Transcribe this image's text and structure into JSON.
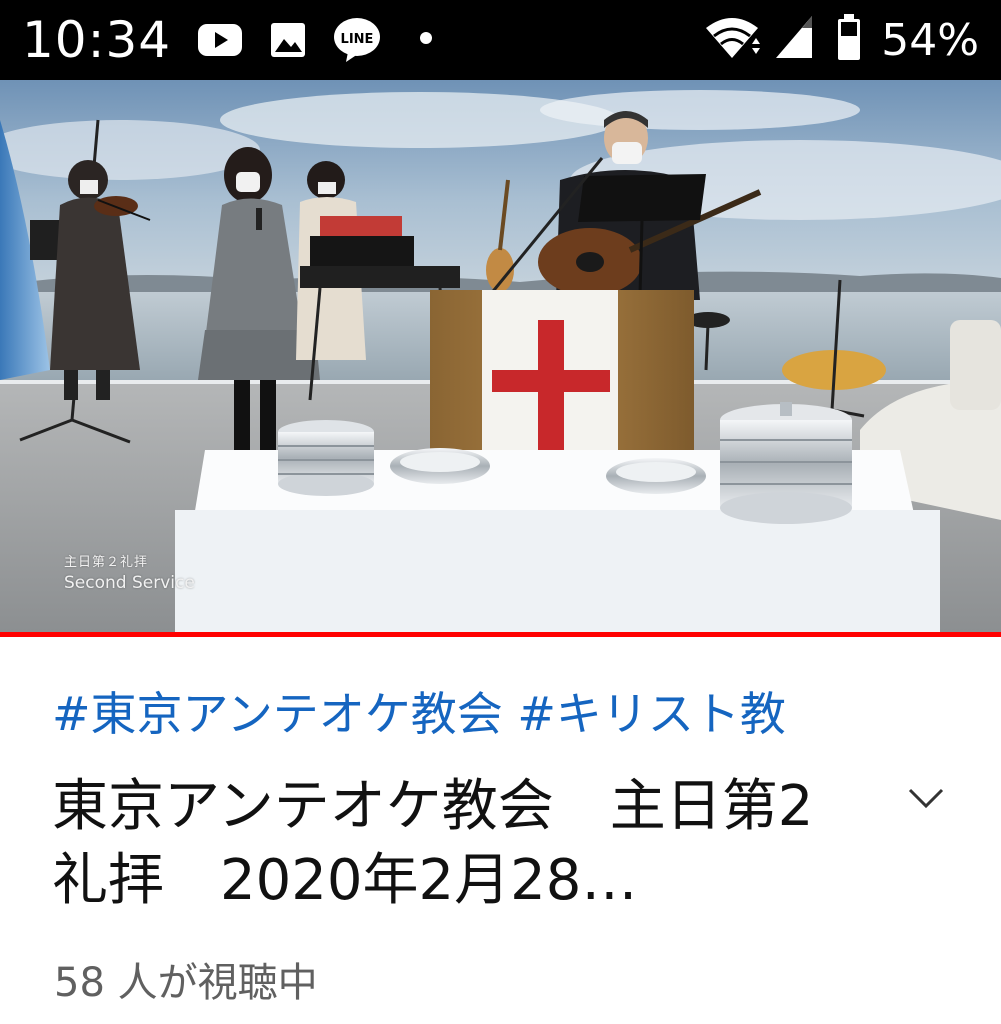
{
  "status_bar": {
    "time": "10:34",
    "battery_percent": "54%",
    "notification_icons": [
      "youtube-icon",
      "image-icon",
      "line-app-icon",
      "dot-icon"
    ],
    "system_icons": [
      "wifi-icon",
      "cellular-signal-icon",
      "battery-icon"
    ]
  },
  "video": {
    "watermark_jp": "主日第２礼拝",
    "watermark_en": "Second Service",
    "progress": 1.0,
    "progress_color": "#ff0000"
  },
  "info": {
    "hashtags": "#東京アンテオケ教会 #キリスト教",
    "title": "東京アンテオケ教会　主日第2礼拝　2020年2月28…",
    "viewers": "58 人が視聴中"
  },
  "colors": {
    "hashtag": "#1565c0",
    "title": "#111111",
    "secondary_text": "#606060"
  }
}
